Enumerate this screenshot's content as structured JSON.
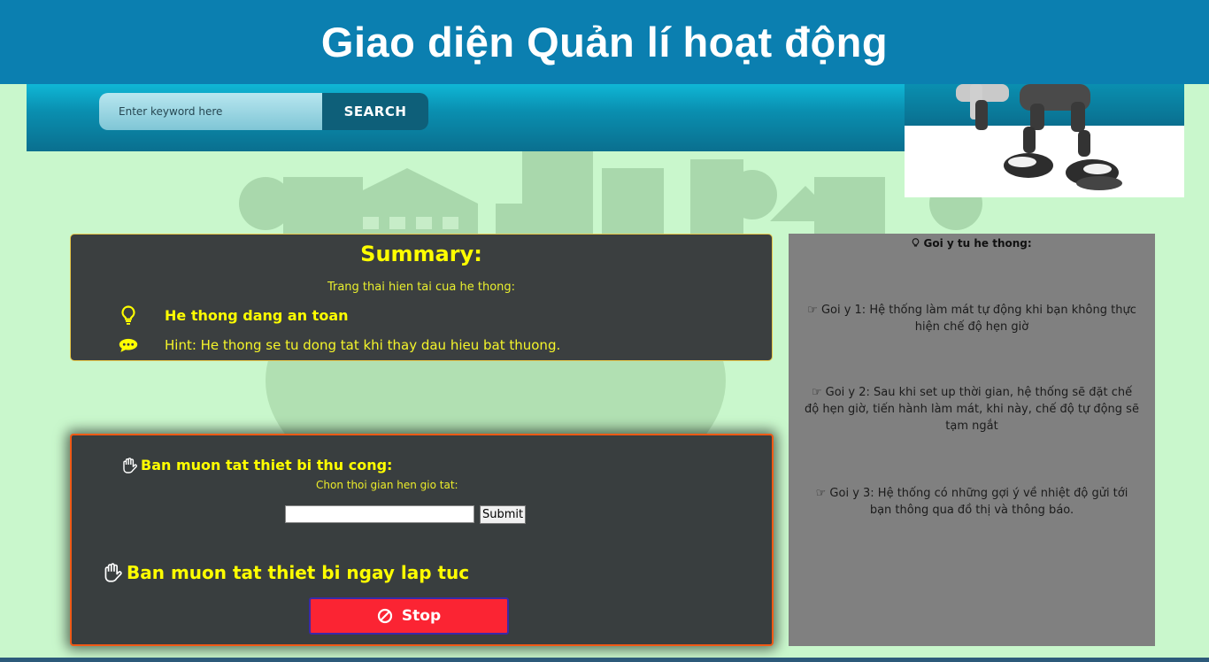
{
  "page": {
    "title": "Giao diện Quản lí hoạt động"
  },
  "search": {
    "placeholder": "Enter keyword here",
    "button_label": "SEARCH"
  },
  "summary": {
    "title": "Summary:",
    "subtitle": "Trang thai hien tai cua he thong:",
    "status_text": "He thong dang an toan",
    "hint_text": "Hint: He thong se tu dong tat khi thay dau hieu bat thuong.",
    "status_icon": "lightbulb-icon",
    "hint_icon": "comment-icon"
  },
  "control": {
    "manual_heading": "Ban muon tat thiet bi thu cong:",
    "choose_time_label": "Chon thoi gian hen gio tat:",
    "time_value": "",
    "submit_label": "Submit",
    "immediate_heading": "Ban muon tat thiet bi ngay lap tuc",
    "stop_label": "Stop",
    "heading_icon": "hand-icon",
    "stop_icon": "ban-icon"
  },
  "suggestions": {
    "title": "Goi y tu he thong:",
    "items": [
      {
        "text": "Goi y 1: Hệ thống làm mát tự động khi bạn không thực hiện chế độ hẹn giờ"
      },
      {
        "text": "Goi y 2: Sau khi set up thời gian, hệ thống sẽ đặt chế độ hẹn giờ, tiến hành làm mát, khi này, chế độ tự động sẽ tạm ngắt"
      },
      {
        "text": "Goi y 3: Hệ thống có những gợi ý về nhiệt độ gửi tới bạn thông qua đồ thị và thông báo."
      }
    ],
    "item_icon": "hand-point-right-icon"
  },
  "colors": {
    "banner": "#0b7fb0",
    "page_background": "#c9f7cc",
    "panel_dark": "#3b3f40",
    "accent_yellow": "#ffff00",
    "stop_red": "#fb2433",
    "suggest_gray": "#808080"
  }
}
